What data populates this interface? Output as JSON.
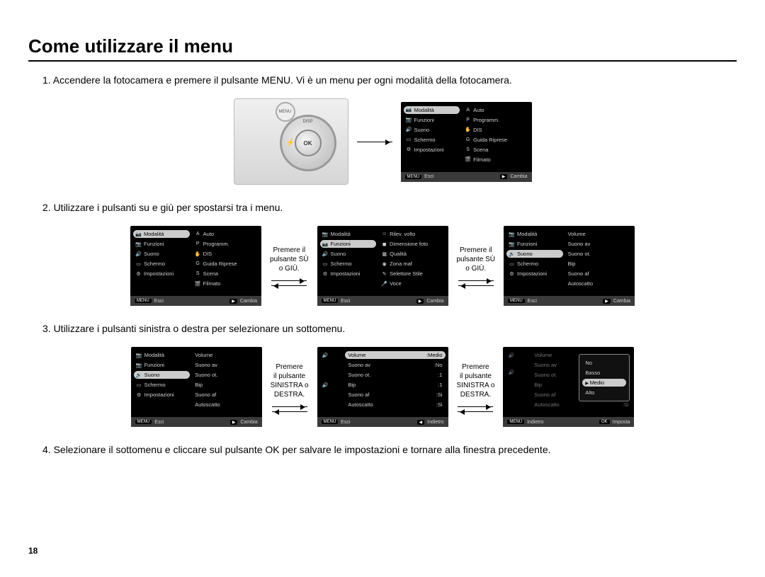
{
  "title": "Come utilizzare il menu",
  "page_number": "18",
  "steps": {
    "s1": "1. Accendere la fotocamera e premere il pulsante MENU. Vi è un menu per ogni modalità della fotocamera.",
    "s2": "2. Utilizzare i pulsanti su e giù per spostarsi tra i menu.",
    "s3": "3. Utilizzare i pulsanti sinistra o destra per selezionare un sottomenu.",
    "s4": "4. Selezionare il sottomenu e cliccare sul pulsante OK per salvare le impostazioni e tornare alla finestra precedente."
  },
  "arrows": {
    "up_down": "Premere il\npulsante SÙ\no GIÙ.",
    "left_right": "Premere\nil pulsante\nSINISTRA o\nDESTRA."
  },
  "camera": {
    "ok": "OK",
    "disp": "DISP",
    "menu": "MENU"
  },
  "lcd_main": {
    "left": [
      "Modalità",
      "Funzioni",
      "Suono",
      "Schermo",
      "Impostazioni"
    ],
    "right": [
      "Auto",
      "Programm.",
      "DIS",
      "Guida Riprese",
      "Scena",
      "Filmato"
    ]
  },
  "lcd_funzioni": {
    "left": [
      "Modalità",
      "Funzioni",
      "Suono",
      "Schermo",
      "Impostazioni"
    ],
    "right": [
      "Rilev. volto",
      "Dimensione foto",
      "Qualità",
      "Zona maf",
      "Selettore Stile",
      "Voce"
    ]
  },
  "lcd_suono": {
    "left": [
      "Modalità",
      "Funzioni",
      "Suono",
      "Schermo",
      "Impostazioni"
    ],
    "right": [
      "Volume",
      "Suono av",
      "Suono ot.",
      "Bip",
      "Suono af",
      "Autoscatto"
    ]
  },
  "lcd_sound_values": {
    "rows": [
      {
        "k": "Volume",
        "v": ":Medio"
      },
      {
        "k": "Suono av",
        "v": ":No"
      },
      {
        "k": "Suono ot.",
        "v": ":1"
      },
      {
        "k": "Bip",
        "v": ":1"
      },
      {
        "k": "Suono af",
        "v": ":Si"
      },
      {
        "k": "Autoscatto",
        "v": ":Si"
      }
    ]
  },
  "popup_opts": [
    "No",
    "Basso",
    "Medio",
    "Alto"
  ],
  "footer": {
    "menu": "MENU",
    "esci": "Esci",
    "play": "▶",
    "cambia": "Cambia",
    "indietro": "Indietro",
    "ok": "OK",
    "imposta": "Imposta"
  },
  "icons": {
    "camera": "📷",
    "gear": "⚙",
    "speaker": "🔊",
    "screen": "▭",
    "mode": "◎",
    "face": "☺",
    "size": "◼",
    "quality": "▦",
    "zone": "◉",
    "style": "✎",
    "voice": "🎤",
    "film": "🎬",
    "scene": "S",
    "dis": "✋",
    "auto": "A",
    "prog": "P",
    "guide": "G",
    "flash": "⚡"
  }
}
